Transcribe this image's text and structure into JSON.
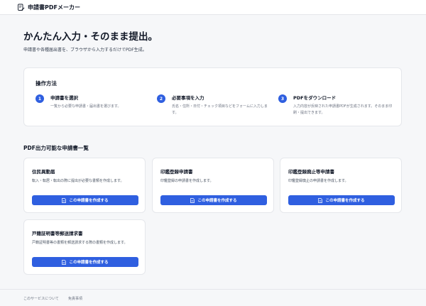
{
  "header": {
    "brand": "申請書PDFメーカー",
    "logo_icon": "document-pen-icon"
  },
  "hero": {
    "title": "かんたん入力・そのまま提出。",
    "subtitle": "申請書や各種届出書を、ブラウザから入力するだけでPDF生成。"
  },
  "steps": {
    "title": "操作方法",
    "items": [
      {
        "number": "1",
        "title": "申請書を選択",
        "desc": "一覧から必要な申請書・届出書を選びます。"
      },
      {
        "number": "2",
        "title": "必要事項を入力",
        "desc": "氏名・住所・日付・チェック項目などをフォームに入力します。"
      },
      {
        "number": "3",
        "title": "PDFをダウンロード",
        "desc": "入力内容が反映された申請書PDFが生成されます。そのまま印刷・提出できます。"
      }
    ]
  },
  "forms": {
    "title": "PDF出力可能な申請書一覧",
    "button_label": "この申請書を作成する",
    "items": [
      {
        "title": "住民異動届",
        "desc": "転入・転居・転出の際に提出が必要な書類を作成します。"
      },
      {
        "title": "印鑑登録申請書",
        "desc": "印鑑登録の申請書を作成します。"
      },
      {
        "title": "印鑑登録廃止等申請書",
        "desc": "印鑑登録廃止の申請書を作成します。"
      },
      {
        "title": "戸籍証明書等郵送請求書",
        "desc": "戸籍証明書等の書類を郵送請求する際の書類を作成します。"
      }
    ]
  },
  "footer": {
    "about": "このサービスについて",
    "disclaimer": "免責事項"
  },
  "colors": {
    "accent": "#2f5fe0",
    "background": "#f6f7f9",
    "card": "#ffffff"
  }
}
